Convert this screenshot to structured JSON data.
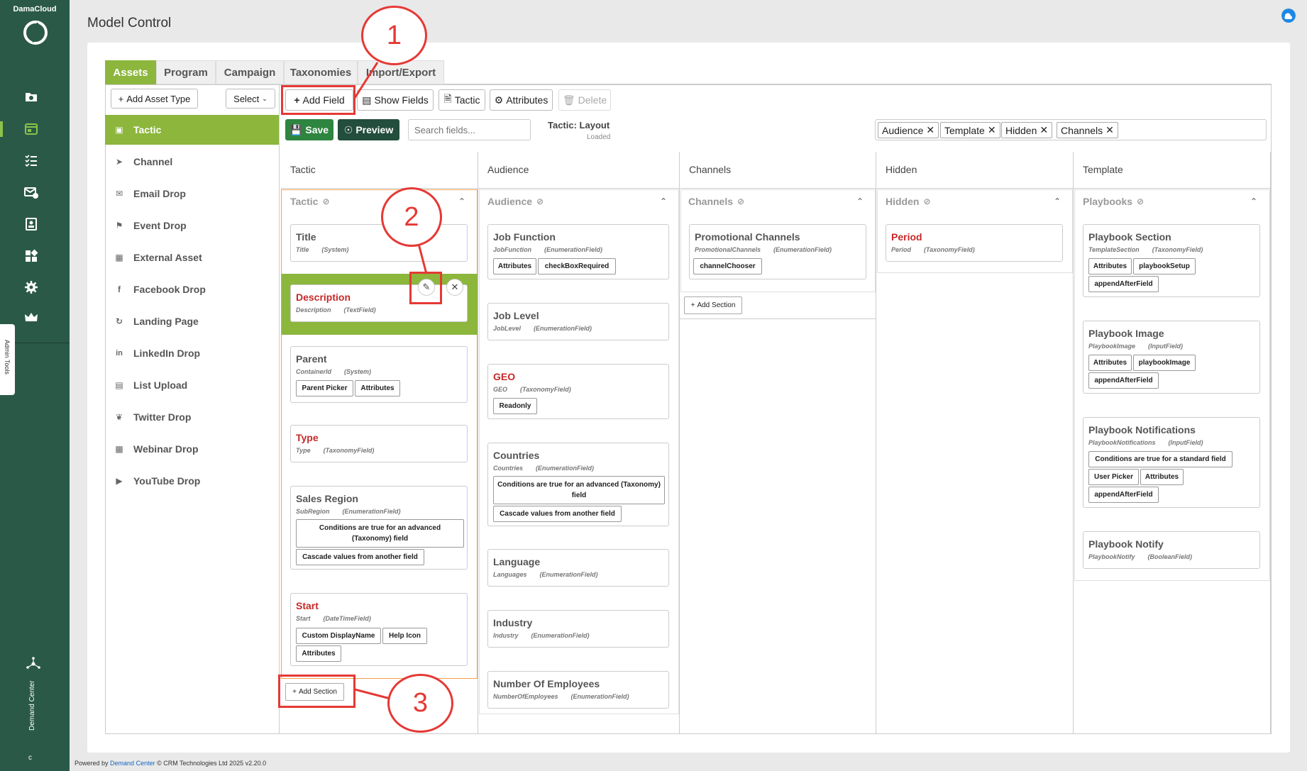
{
  "rail": {
    "brand": "DamaCloud",
    "icons": [
      "camera-folder-icon",
      "layout-icon",
      "checklist-icon",
      "mail-check-icon",
      "contact-card-icon",
      "widgets-icon",
      "gear-icon",
      "crown-icon"
    ],
    "admin_tools": "Admin Tools",
    "demand_center": "Demand Center",
    "bottom": "c"
  },
  "header": {
    "title": "Model Control"
  },
  "tabs": [
    "Assets",
    "Program",
    "Campaign",
    "Taxonomies",
    "Import/Export"
  ],
  "sidebar": {
    "add_asset_type": "Add Asset Type",
    "select": "Select",
    "items": [
      {
        "label": "Tactic",
        "icon": "briefcase-icon"
      },
      {
        "label": "Channel",
        "icon": "megaphone-icon"
      },
      {
        "label": "Email Drop",
        "icon": "envelope-icon"
      },
      {
        "label": "Event Drop",
        "icon": "flag-icon"
      },
      {
        "label": "External Asset",
        "icon": "building-icon"
      },
      {
        "label": "Facebook Drop",
        "icon": "facebook-icon"
      },
      {
        "label": "Landing Page",
        "icon": "landing-page-icon"
      },
      {
        "label": "LinkedIn Drop",
        "icon": "linkedin-icon"
      },
      {
        "label": "List Upload",
        "icon": "list-upload-icon"
      },
      {
        "label": "Twitter Drop",
        "icon": "twitter-icon"
      },
      {
        "label": "Webinar Drop",
        "icon": "webinar-icon"
      },
      {
        "label": "YouTube Drop",
        "icon": "youtube-icon"
      }
    ]
  },
  "toolbar": {
    "add_field": "Add Field",
    "show_fields": "Show Fields",
    "tactic": "Tactic",
    "attributes": "Attributes",
    "delete": "Delete",
    "save": "Save",
    "preview": "Preview",
    "search_placeholder": "Search fields...",
    "layout_title": "Tactic: Layout",
    "layout_status": "Loaded",
    "tags": [
      "Audience",
      "Template",
      "Hidden",
      "Channels"
    ]
  },
  "columns": {
    "tactic": {
      "header": "Tactic",
      "section": "Tactic",
      "fields": [
        {
          "name": "Title",
          "key": "Title",
          "type": "(System)"
        },
        {
          "name": "Description",
          "key": "Description",
          "type": "(TextField)"
        },
        {
          "name": "Parent",
          "key": "ContainerId",
          "type": "(System)",
          "chips": [
            "Parent Picker",
            "Attributes"
          ]
        },
        {
          "name": "Type",
          "key": "Type",
          "type": "(TaxonomyField)"
        },
        {
          "name": "Sales Region",
          "key": "SubRegion",
          "type": "(EnumerationField)",
          "chips": [
            "Conditions are true for an advanced (Taxonomy) field",
            "Cascade values from another field"
          ]
        },
        {
          "name": "Start",
          "key": "Start",
          "type": "(DateTimeField)",
          "chips": [
            "Custom DisplayName",
            "Help Icon",
            "Attributes"
          ]
        }
      ],
      "add_section": "Add Section"
    },
    "audience": {
      "header": "Audience",
      "section": "Audience",
      "fields": [
        {
          "name": "Job Function",
          "key": "JobFunction",
          "type": "(EnumerationField)",
          "chips": [
            "Attributes",
            "checkBoxRequired"
          ]
        },
        {
          "name": "Job Level",
          "key": "JobLevel",
          "type": "(EnumerationField)"
        },
        {
          "name": "GEO",
          "key": "GEO",
          "type": "(TaxonomyField)",
          "chips": [
            "Readonly"
          ]
        },
        {
          "name": "Countries",
          "key": "Countries",
          "type": "(EnumerationField)",
          "chips": [
            "Conditions are true for an advanced (Taxonomy) field",
            "Cascade values from another field"
          ]
        },
        {
          "name": "Language",
          "key": "Languages",
          "type": "(EnumerationField)"
        },
        {
          "name": "Industry",
          "key": "Industry",
          "type": "(EnumerationField)"
        },
        {
          "name": "Number Of Employees",
          "key": "NumberOfEmployees",
          "type": "(EnumerationField)"
        }
      ]
    },
    "channels": {
      "header": "Channels",
      "section": "Channels",
      "fields": [
        {
          "name": "Promotional Channels",
          "key": "PromotionalChannels",
          "type": "(EnumerationField)",
          "chips": [
            "channelChooser"
          ]
        }
      ],
      "add_section": "Add Section"
    },
    "hidden": {
      "header": "Hidden",
      "section": "Hidden",
      "fields": [
        {
          "name": "Period",
          "key": "Period",
          "type": "(TaxonomyField)"
        }
      ]
    },
    "template": {
      "header": "Template",
      "section": "Playbooks",
      "fields": [
        {
          "name": "Playbook Section",
          "key": "TemplateSection",
          "type": "(TaxonomyField)",
          "chips": [
            "Attributes",
            "playbookSetup",
            "appendAfterField"
          ]
        },
        {
          "name": "Playbook Image",
          "key": "PlaybookImage",
          "type": "(InputField)",
          "chips": [
            "Attributes",
            "playbookImage",
            "appendAfterField"
          ]
        },
        {
          "name": "Playbook Notifications",
          "key": "PlaybookNotifications",
          "type": "(InputField)",
          "chips": [
            "Conditions are true for a standard field",
            "User Picker",
            "Attributes",
            "appendAfterField"
          ]
        },
        {
          "name": "Playbook Notify",
          "key": "PlaybookNotify",
          "type": "(BooleanField)"
        }
      ]
    }
  },
  "callouts": [
    "1",
    "2",
    "3"
  ],
  "footer": {
    "prefix": "Powered by",
    "link": "Demand Center",
    "suffix": "© CRM Technologies Ltd 2025 v2.20.0"
  },
  "colors": {
    "rail": "#2a5a47",
    "accent": "#8cb63c",
    "save": "#2e8540",
    "annotation": "#e53935",
    "required_field": "#c62828"
  }
}
